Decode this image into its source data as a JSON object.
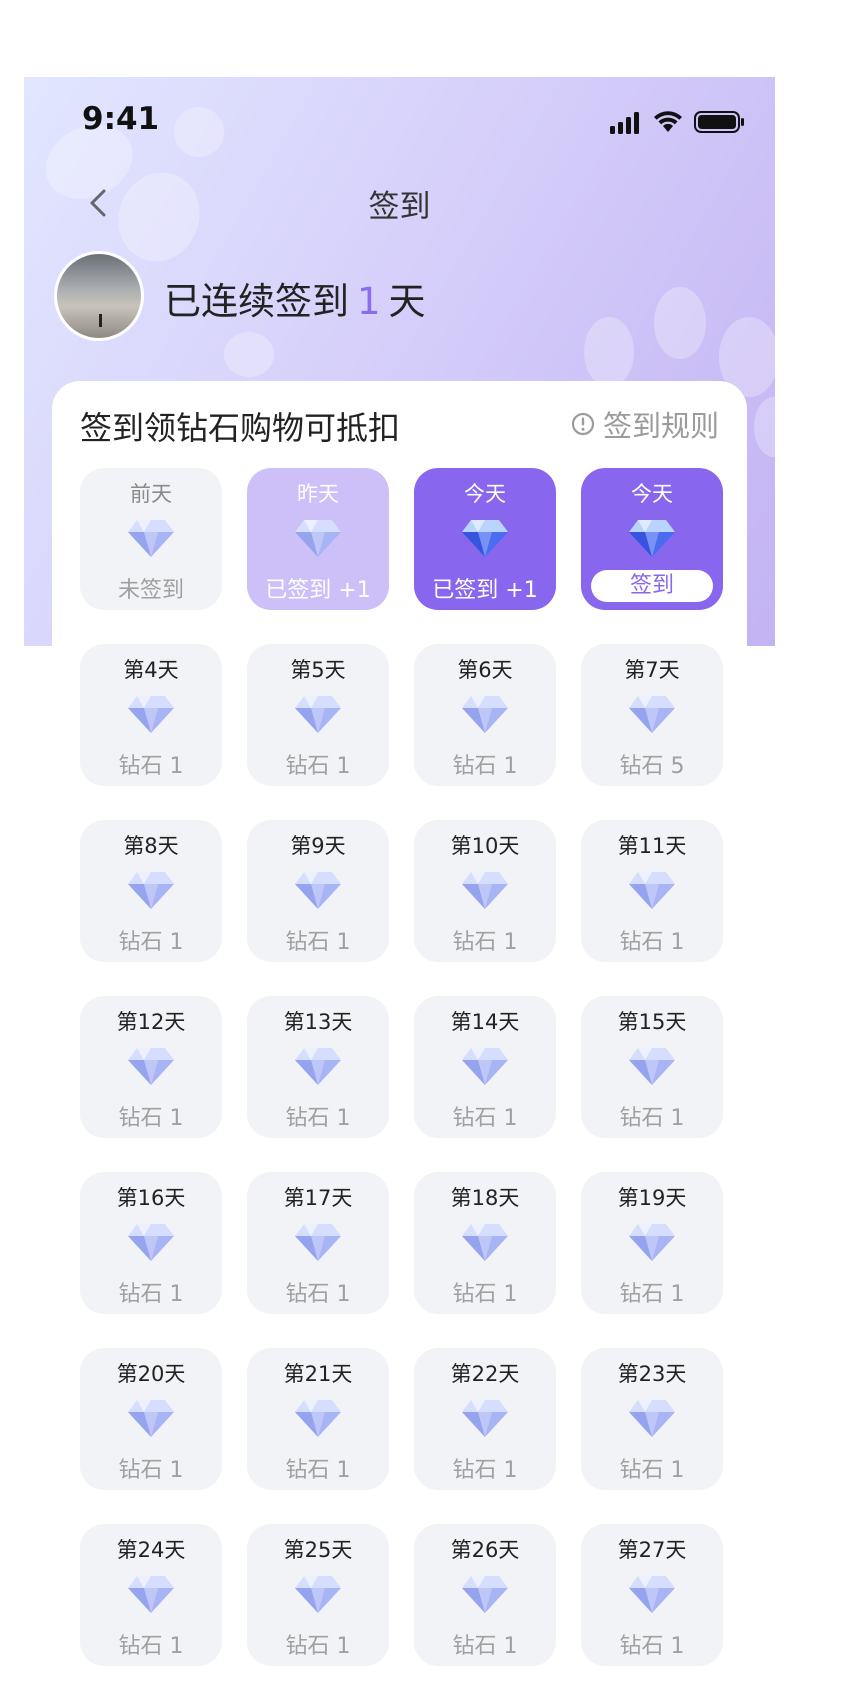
{
  "status_bar": {
    "time": "9:41"
  },
  "nav": {
    "title": "签到",
    "back_icon": "chevron-left-icon"
  },
  "user": {
    "streak_prefix": "已连续签到",
    "streak_days": "1",
    "streak_suffix": "天"
  },
  "card": {
    "title": "签到领钻石购物可抵扣",
    "rules_label": "签到规则",
    "rules_icon": "info-circle-icon"
  },
  "colors": {
    "accent": "#8866ee",
    "signed_bg": "#cdbff7",
    "cell_bg": "#f2f3f6",
    "muted_text": "#a0a0a0"
  },
  "days": [
    {
      "day": "前天",
      "reward": "未签到",
      "state": "past"
    },
    {
      "day": "昨天",
      "reward": "已签到 +1",
      "state": "signed"
    },
    {
      "day": "今天",
      "reward": "已签到 +1",
      "state": "today"
    },
    {
      "day": "今天",
      "reward": "签到",
      "state": "today-button"
    },
    {
      "day": "第4天",
      "reward": "钻石 1",
      "state": "future"
    },
    {
      "day": "第5天",
      "reward": "钻石 1",
      "state": "future"
    },
    {
      "day": "第6天",
      "reward": "钻石 1",
      "state": "future"
    },
    {
      "day": "第7天",
      "reward": "钻石 5",
      "state": "future"
    },
    {
      "day": "第8天",
      "reward": "钻石 1",
      "state": "future"
    },
    {
      "day": "第9天",
      "reward": "钻石 1",
      "state": "future"
    },
    {
      "day": "第10天",
      "reward": "钻石 1",
      "state": "future"
    },
    {
      "day": "第11天",
      "reward": "钻石 1",
      "state": "future"
    },
    {
      "day": "第12天",
      "reward": "钻石 1",
      "state": "future"
    },
    {
      "day": "第13天",
      "reward": "钻石 1",
      "state": "future"
    },
    {
      "day": "第14天",
      "reward": "钻石 1",
      "state": "future"
    },
    {
      "day": "第15天",
      "reward": "钻石 1",
      "state": "future"
    },
    {
      "day": "第16天",
      "reward": "钻石 1",
      "state": "future"
    },
    {
      "day": "第17天",
      "reward": "钻石 1",
      "state": "future"
    },
    {
      "day": "第18天",
      "reward": "钻石 1",
      "state": "future"
    },
    {
      "day": "第19天",
      "reward": "钻石 1",
      "state": "future"
    },
    {
      "day": "第20天",
      "reward": "钻石 1",
      "state": "future"
    },
    {
      "day": "第21天",
      "reward": "钻石 1",
      "state": "future"
    },
    {
      "day": "第22天",
      "reward": "钻石 1",
      "state": "future"
    },
    {
      "day": "第23天",
      "reward": "钻石 1",
      "state": "future"
    },
    {
      "day": "第24天",
      "reward": "钻石 1",
      "state": "future"
    },
    {
      "day": "第25天",
      "reward": "钻石 1",
      "state": "future"
    },
    {
      "day": "第26天",
      "reward": "钻石 1",
      "state": "future"
    },
    {
      "day": "第27天",
      "reward": "钻石 1",
      "state": "future"
    }
  ]
}
